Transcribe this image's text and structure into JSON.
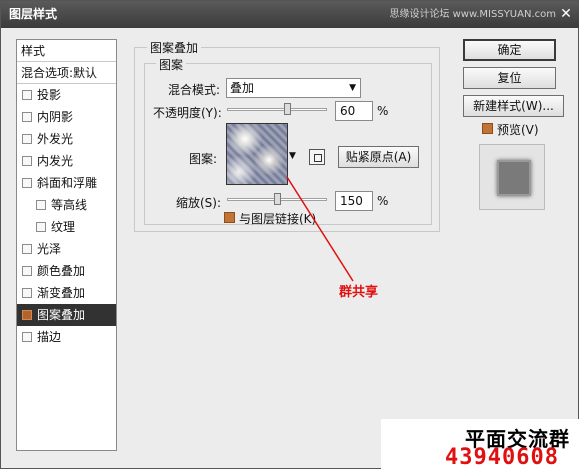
{
  "window": {
    "title": "图层样式",
    "watermark": "思缘设计论坛 www.MISSYUAN.com",
    "close": "✕"
  },
  "style_list": [
    {
      "label": "样式",
      "type": "header"
    },
    {
      "label": "混合选项:默认",
      "type": "header"
    },
    {
      "label": "投影",
      "type": "item",
      "checked": false
    },
    {
      "label": "内阴影",
      "type": "item",
      "checked": false
    },
    {
      "label": "外发光",
      "type": "item",
      "checked": false
    },
    {
      "label": "内发光",
      "type": "item",
      "checked": false
    },
    {
      "label": "斜面和浮雕",
      "type": "item",
      "checked": false
    },
    {
      "label": "等高线",
      "type": "sub",
      "checked": false
    },
    {
      "label": "纹理",
      "type": "sub",
      "checked": false
    },
    {
      "label": "光泽",
      "type": "item",
      "checked": false
    },
    {
      "label": "颜色叠加",
      "type": "item",
      "checked": false
    },
    {
      "label": "渐变叠加",
      "type": "item",
      "checked": false
    },
    {
      "label": "图案叠加",
      "type": "item",
      "checked": true,
      "selected": true
    },
    {
      "label": "描边",
      "type": "item",
      "checked": false
    }
  ],
  "panel": {
    "group_title": "图案叠加",
    "sub_group_title": "图案",
    "blend_mode_label": "混合模式:",
    "blend_mode_value": "叠加",
    "opacity_label": "不透明度(Y):",
    "opacity_value": "60",
    "opacity_fraction": 0.6,
    "opacity_unit": "%",
    "pattern_label": "图案:",
    "snap_origin_button": "贴紧原点(A)",
    "scale_label": "缩放(S):",
    "scale_value": "150",
    "scale_fraction": 0.5,
    "scale_unit": "%",
    "link_layer_label": "与图层链接(K)"
  },
  "buttons": {
    "ok": "确定",
    "reset": "复位",
    "new_style": "新建样式(W)...",
    "preview_label": "预览(V)"
  },
  "annotation": "群共享",
  "watermark_corner": {
    "line1": "平面交流群",
    "line2": "43940608"
  },
  "colors": {
    "accent_swatch": "#c27434",
    "annotation": "#e01010"
  }
}
